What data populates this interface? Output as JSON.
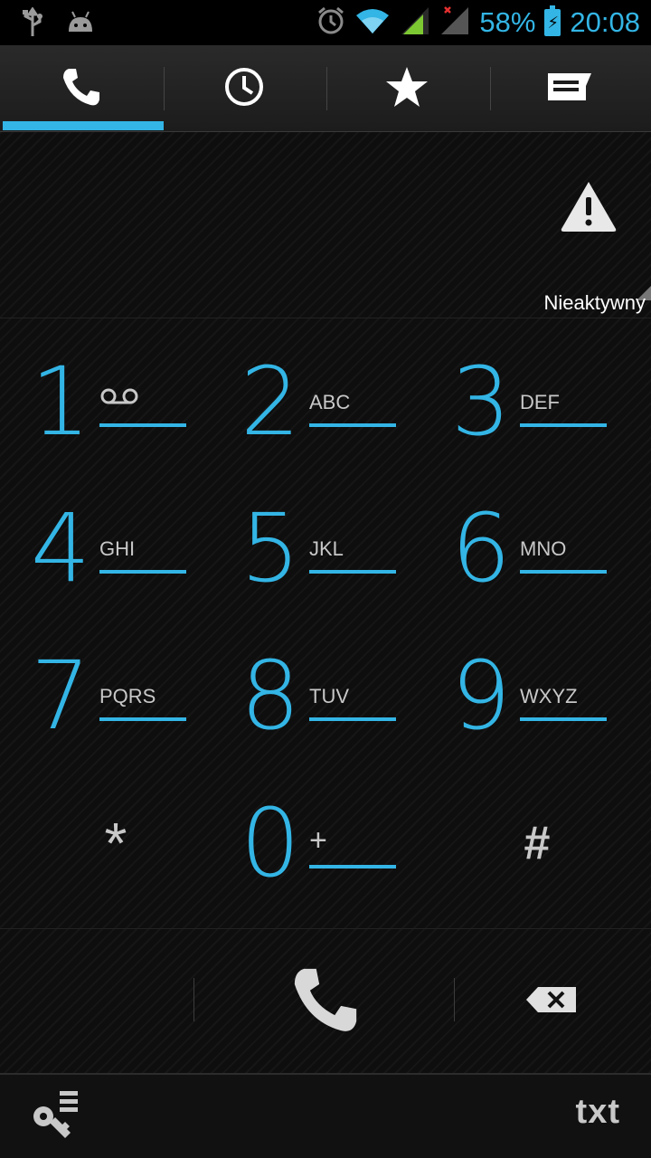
{
  "status_bar": {
    "battery_percent": "58%",
    "time": "20:08",
    "icons": [
      "usb-icon",
      "android-debug-icon",
      "alarm-icon",
      "wifi-icon",
      "signal-icon",
      "signal-no-service-icon",
      "battery-charging-icon"
    ]
  },
  "tabs": [
    {
      "name": "dialer",
      "icon": "phone-icon",
      "selected": true
    },
    {
      "name": "call-log",
      "icon": "clock-icon",
      "selected": false
    },
    {
      "name": "favorites",
      "icon": "star-icon",
      "selected": false
    },
    {
      "name": "contacts",
      "icon": "contact-card-icon",
      "selected": false
    }
  ],
  "digits_area": {
    "status_label": "Nieaktywny",
    "warning_icon": "warning-icon"
  },
  "keypad": [
    {
      "digit": "1",
      "letters": "",
      "icon": "voicemail-icon"
    },
    {
      "digit": "2",
      "letters": "ABC"
    },
    {
      "digit": "3",
      "letters": "DEF"
    },
    {
      "digit": "4",
      "letters": "GHI"
    },
    {
      "digit": "5",
      "letters": "JKL"
    },
    {
      "digit": "6",
      "letters": "MNO"
    },
    {
      "digit": "7",
      "letters": "PQRS"
    },
    {
      "digit": "8",
      "letters": "TUV"
    },
    {
      "digit": "9",
      "letters": "WXYZ"
    },
    {
      "digit": "*",
      "letters": ""
    },
    {
      "digit": "0",
      "letters": "+"
    },
    {
      "digit": "#",
      "letters": ""
    }
  ],
  "bottom_bar": {
    "txt_label": "txt"
  },
  "colors": {
    "accent": "#33b5e5",
    "background": "#000000"
  }
}
